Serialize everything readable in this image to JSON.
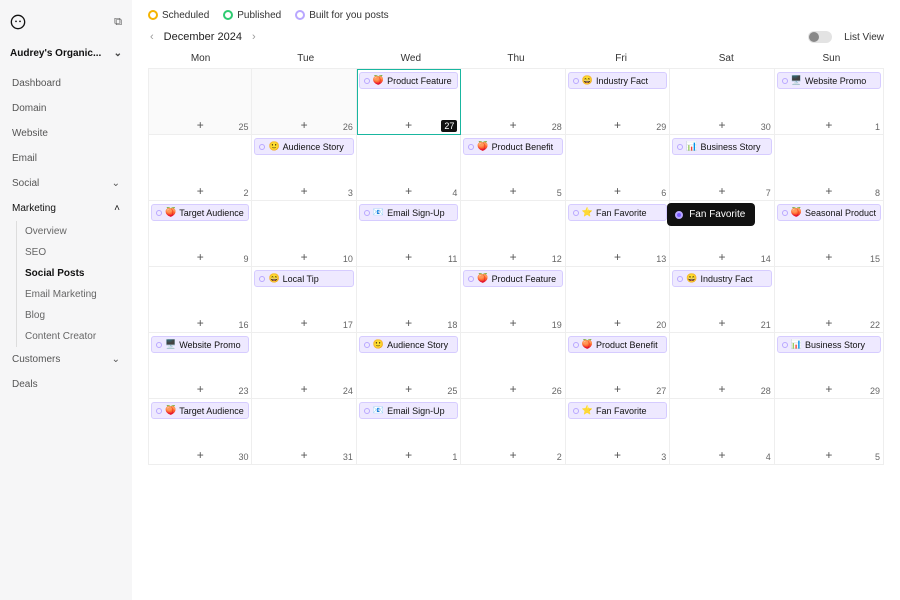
{
  "sidebar": {
    "store_name": "Audrey's Organic...",
    "items": [
      {
        "label": "Dashboard"
      },
      {
        "label": "Domain"
      },
      {
        "label": "Website"
      },
      {
        "label": "Email"
      },
      {
        "label": "Social",
        "expandable": true
      },
      {
        "label": "Marketing",
        "expandable": true,
        "expanded": true,
        "children": [
          {
            "label": "Overview"
          },
          {
            "label": "SEO"
          },
          {
            "label": "Social Posts",
            "active": true
          },
          {
            "label": "Email Marketing"
          },
          {
            "label": "Blog"
          },
          {
            "label": "Content Creator"
          }
        ]
      },
      {
        "label": "Customers",
        "expandable": true
      },
      {
        "label": "Deals"
      }
    ]
  },
  "legend": {
    "scheduled": "Scheduled",
    "published": "Published",
    "built": "Built for you posts"
  },
  "header": {
    "month_label": "December 2024",
    "list_view_label": "List View"
  },
  "dow": [
    "Mon",
    "Tue",
    "Wed",
    "Thu",
    "Fri",
    "Sat",
    "Sun"
  ],
  "tooltip_label": "Fan Favorite",
  "cells": [
    {
      "date": "25",
      "prev": true
    },
    {
      "date": "26",
      "prev": true
    },
    {
      "date": "27",
      "today": true,
      "event": {
        "emoji": "🍑",
        "label": "Product Feature"
      }
    },
    {
      "date": "28"
    },
    {
      "date": "29",
      "event": {
        "emoji": "😄",
        "label": "Industry Fact"
      }
    },
    {
      "date": "30"
    },
    {
      "date": "1",
      "event": {
        "emoji": "🖥️",
        "label": "Website Promo"
      }
    },
    {
      "date": "2"
    },
    {
      "date": "3",
      "event": {
        "emoji": "🙂",
        "label": "Audience Story"
      }
    },
    {
      "date": "4"
    },
    {
      "date": "5",
      "event": {
        "emoji": "🍑",
        "label": "Product Benefit"
      }
    },
    {
      "date": "6"
    },
    {
      "date": "7",
      "event": {
        "emoji": "📊",
        "label": "Business Story"
      }
    },
    {
      "date": "8"
    },
    {
      "date": "9",
      "event": {
        "emoji": "🍑",
        "label": "Target Audience"
      }
    },
    {
      "date": "10"
    },
    {
      "date": "11",
      "event": {
        "emoji": "📧",
        "label": "Email Sign-Up"
      }
    },
    {
      "date": "12"
    },
    {
      "date": "13",
      "event": {
        "emoji": "⭐",
        "label": "Fan Favorite"
      },
      "tooltip": true
    },
    {
      "date": "14"
    },
    {
      "date": "15",
      "event": {
        "emoji": "🍑",
        "label": "Seasonal Product"
      }
    },
    {
      "date": "16"
    },
    {
      "date": "17",
      "event": {
        "emoji": "😄",
        "label": "Local Tip"
      }
    },
    {
      "date": "18"
    },
    {
      "date": "19",
      "event": {
        "emoji": "🍑",
        "label": "Product Feature"
      }
    },
    {
      "date": "20"
    },
    {
      "date": "21",
      "event": {
        "emoji": "😄",
        "label": "Industry Fact"
      }
    },
    {
      "date": "22"
    },
    {
      "date": "23",
      "event": {
        "emoji": "🖥️",
        "label": "Website Promo"
      }
    },
    {
      "date": "24"
    },
    {
      "date": "25",
      "event": {
        "emoji": "🙂",
        "label": "Audience Story"
      }
    },
    {
      "date": "26"
    },
    {
      "date": "27",
      "event": {
        "emoji": "🍑",
        "label": "Product Benefit"
      }
    },
    {
      "date": "28"
    },
    {
      "date": "29",
      "event": {
        "emoji": "📊",
        "label": "Business Story"
      }
    },
    {
      "date": "30",
      "event": {
        "emoji": "🍑",
        "label": "Target Audience"
      }
    },
    {
      "date": "31"
    },
    {
      "date": "1",
      "event": {
        "emoji": "📧",
        "label": "Email Sign-Up"
      }
    },
    {
      "date": "2"
    },
    {
      "date": "3",
      "event": {
        "emoji": "⭐",
        "label": "Fan Favorite"
      }
    },
    {
      "date": "4"
    },
    {
      "date": "5"
    }
  ]
}
